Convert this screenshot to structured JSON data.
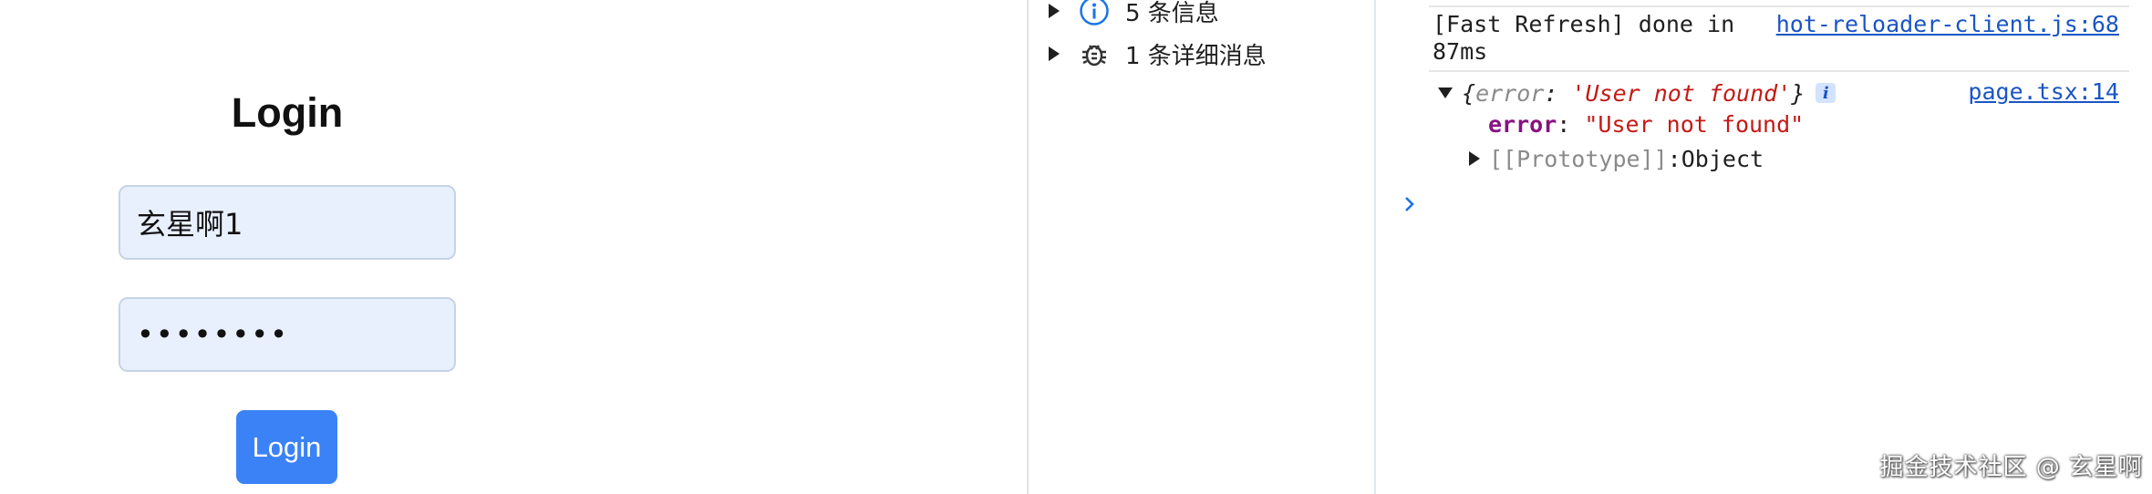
{
  "login": {
    "title": "Login",
    "username_value": "玄星啊1",
    "password_value": "••••••••",
    "button_label": "Login"
  },
  "console_sidebar": {
    "items": [
      {
        "label": "5 条信息",
        "icon": "info-icon"
      },
      {
        "label": "1 条详细消息",
        "icon": "bug-icon"
      }
    ]
  },
  "console": {
    "refresh_message": "[Fast Refresh] done in 87ms",
    "refresh_source": "hot-reloader-client.js:68",
    "object_open": "{",
    "object_key": "error",
    "object_colon": ": ",
    "object_value": "'User not found'",
    "object_close": "}",
    "info_badge": "i",
    "object_source": "page.tsx:14",
    "prop_key": "error",
    "prop_colon": ": ",
    "prop_value": "\"User not found\"",
    "proto_key": "[[Prototype]]",
    "proto_colon": ": ",
    "proto_value": "Object"
  },
  "watermark": "掘金技术社区 @ 玄星啊",
  "colors": {
    "login_button": "#3b82f6",
    "input_background": "#e8f0fe",
    "link": "#1a55c4",
    "string_red": "#c41a16",
    "property_purple": "#881280"
  }
}
